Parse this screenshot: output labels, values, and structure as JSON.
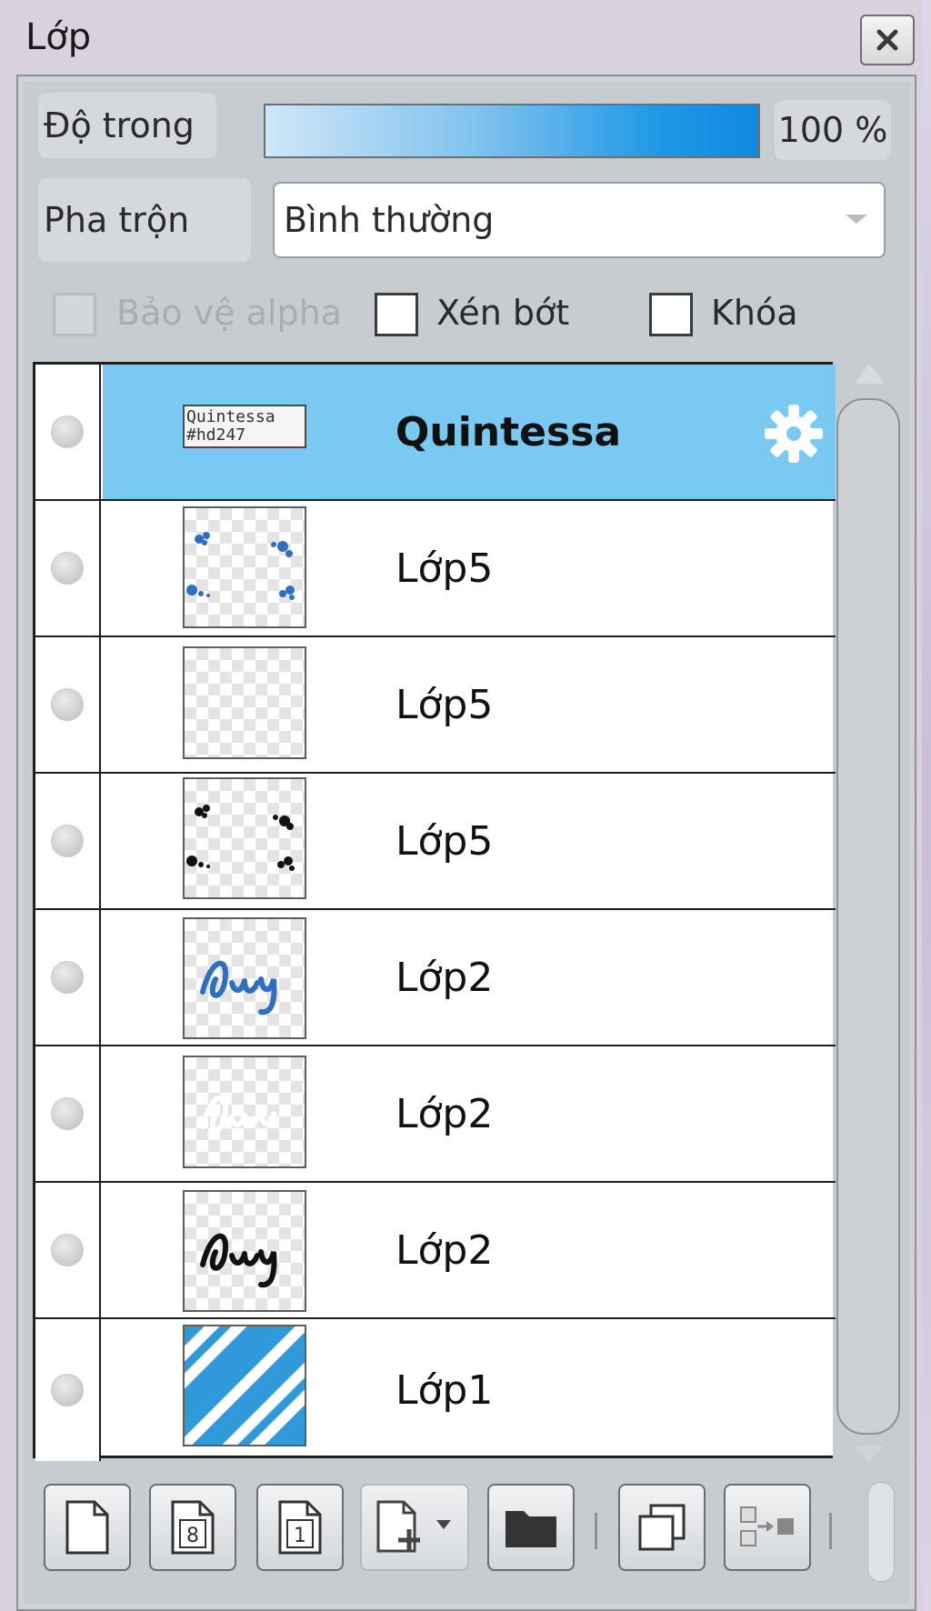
{
  "window": {
    "title": "Lớp"
  },
  "controls": {
    "opacity_label": "Độ trong",
    "opacity_value": "100 %",
    "opacity_level": 1.0,
    "blend_label": "Pha trộn",
    "blend_value": "Bình thường",
    "checkboxes": [
      {
        "label": "Bảo vệ alpha",
        "checked": false,
        "disabled": true
      },
      {
        "label": "Xén bớt",
        "checked": false,
        "disabled": false
      },
      {
        "label": "Khóa",
        "checked": false,
        "disabled": false
      }
    ]
  },
  "layers": [
    {
      "name": "Quintessa",
      "selected": true,
      "thumb": "text-thumbnail",
      "thumb_text_1": "Quintessa",
      "thumb_text_2": "#hd247"
    },
    {
      "name": "Lớp5",
      "selected": false,
      "thumb": "blue-dots"
    },
    {
      "name": "Lớp5",
      "selected": false,
      "thumb": "empty"
    },
    {
      "name": "Lớp5",
      "selected": false,
      "thumb": "black-dots"
    },
    {
      "name": "Lớp2",
      "selected": false,
      "thumb": "blue-script"
    },
    {
      "name": "Lớp2",
      "selected": false,
      "thumb": "white-script"
    },
    {
      "name": "Lớp2",
      "selected": false,
      "thumb": "black-script"
    },
    {
      "name": "Lớp1",
      "selected": false,
      "thumb": "blue-stripes"
    }
  ],
  "toolbar": {
    "buttons": [
      "new-layer-icon",
      "new-8bit-layer-icon",
      "new-1bit-layer-icon",
      "add-layer-dropdown-icon",
      "new-folder-icon",
      "duplicate-layer-icon",
      "merge-layer-icon"
    ],
    "badge_8": "8",
    "badge_1": "1"
  },
  "colors": {
    "selected_row": "#79c9f3",
    "opacity_fill": "#0f8ae2",
    "thumb_blue": "#2f6fc1",
    "stripes_blue": "#2f9ad9"
  }
}
